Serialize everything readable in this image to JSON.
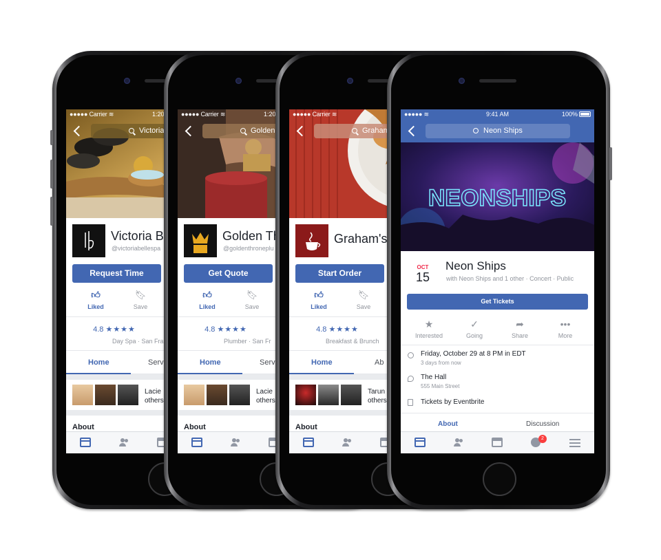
{
  "status_bar": {
    "carrier": "●●●●● Carrier ≋",
    "time_partial": "1:20",
    "time": "9:41 AM",
    "battery": "100%"
  },
  "pages": [
    {
      "search": "Victoria Be",
      "name": "Victoria Be",
      "handle": "@victoriabellespa",
      "cta": "Request Time",
      "liked": "Liked",
      "save": "Save",
      "rating": "4.8",
      "stars": "★★★★",
      "category": "Day Spa · San Fra",
      "tab_home": "Home",
      "tab_second": "Serv",
      "friends_text_1": "Lacie",
      "friends_text_2": "others",
      "about": "About",
      "accent": "#c8a24a"
    },
    {
      "search": "Golden Thr",
      "name": "Golden Th",
      "handle": "@goldenthroneplu",
      "cta": "Get Quote",
      "liked": "Liked",
      "save": "Save",
      "rating": "4.8",
      "stars": "★★★★",
      "category": "Plumber · San Fr",
      "tab_home": "Home",
      "tab_second": "Serv",
      "friends_text_1": "Lacie",
      "friends_text_2": "others",
      "about": "About",
      "accent": "#e8a820"
    },
    {
      "search": "Graham",
      "name": "Graham's",
      "handle": "",
      "cta": "Start Order",
      "liked": "Liked",
      "save": "Save",
      "rating": "4.8",
      "stars": "★★★★",
      "category": "Breakfast & Brunch",
      "tab_home": "Home",
      "tab_second": "Ab",
      "friends_text_1": "Tarun",
      "friends_text_2": "others",
      "about": "About",
      "accent": "#8b1a1a"
    }
  ],
  "event": {
    "search": "Neon Ships",
    "cover_text": "NEONSHIPS",
    "month": "OCT",
    "day": "15",
    "title": "Neon Ships",
    "subtitle": "with Neon Ships and 1 other · Concert · Public",
    "get_tickets": "Get Tickets",
    "actions": [
      "Interested",
      "Going",
      "Share",
      "More"
    ],
    "datetime": "Friday, October 29 at 8 PM in EDT",
    "relative": "3 days from now",
    "venue": "The Hall",
    "address": "555 Main Street",
    "tickets": "Tickets by Eventbrite",
    "tab_about": "About",
    "tab_discussion": "Discussion",
    "notification_count": "2"
  }
}
